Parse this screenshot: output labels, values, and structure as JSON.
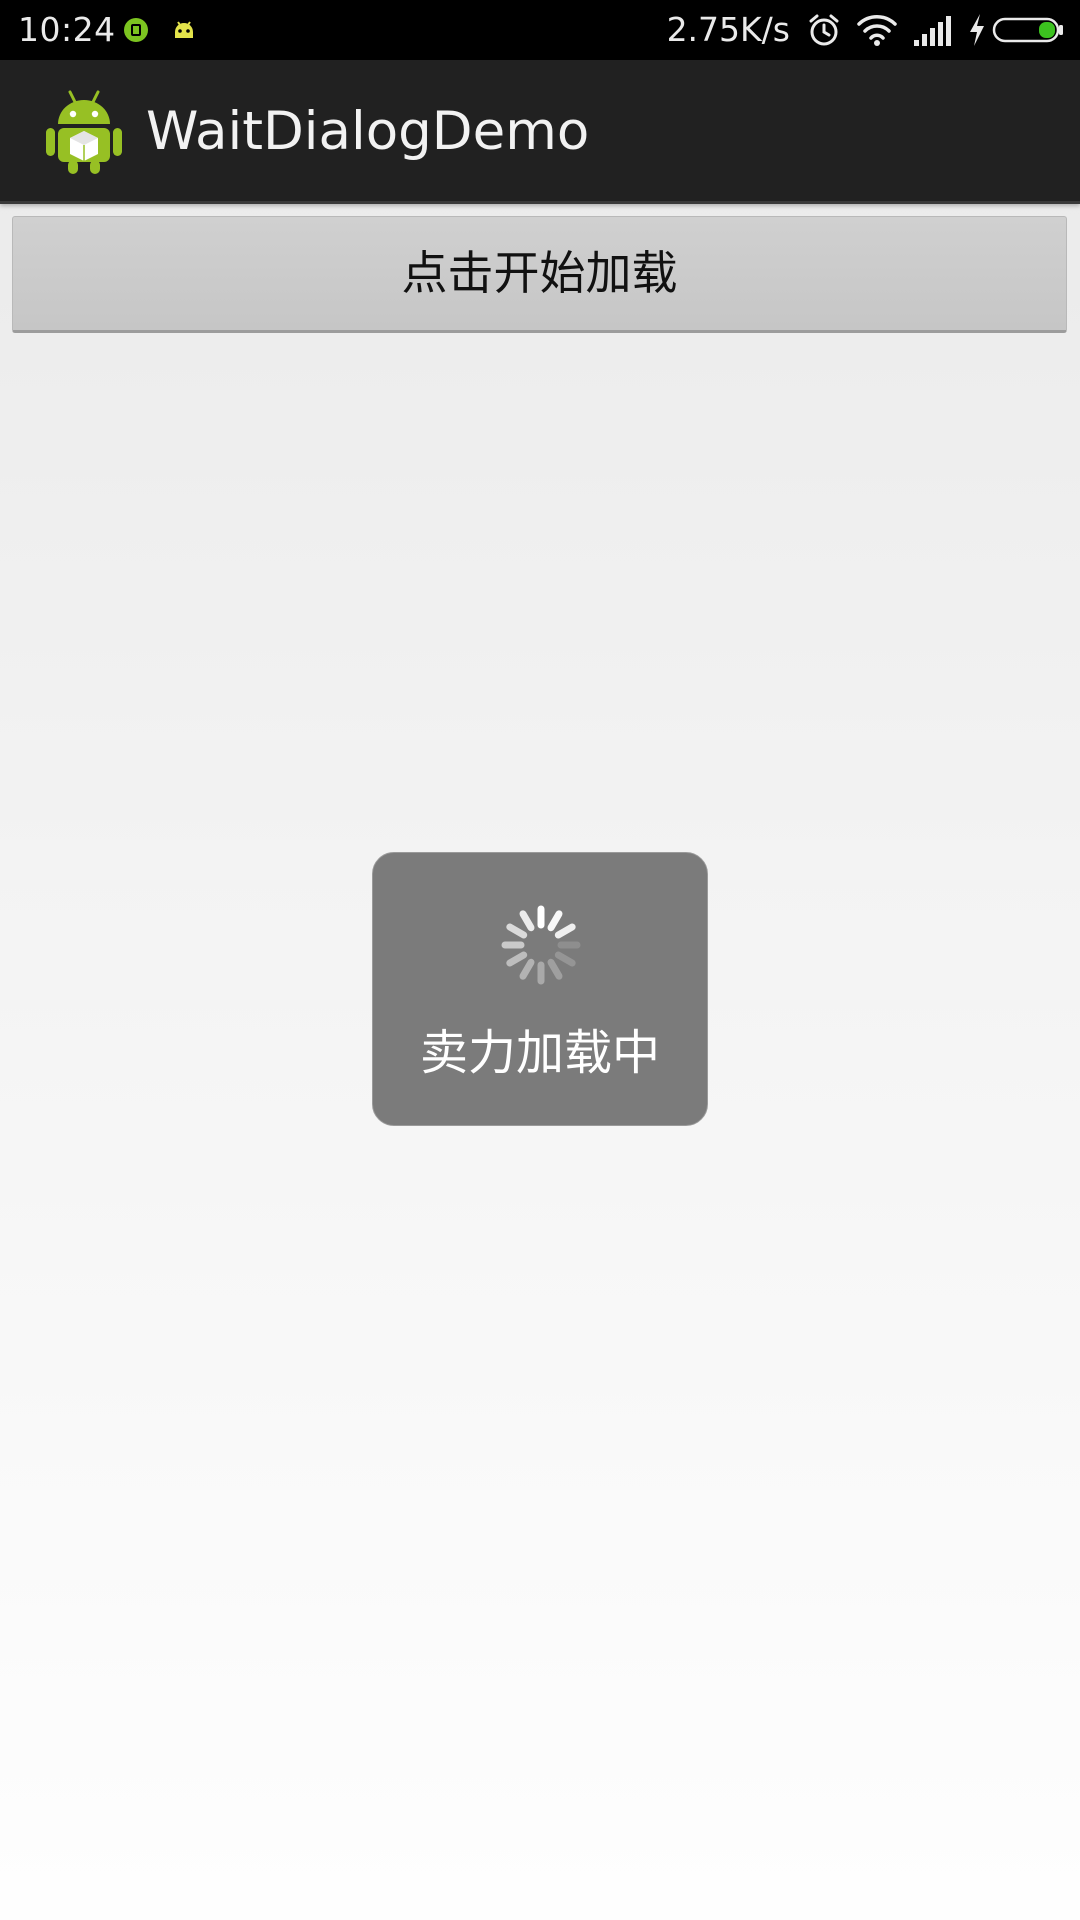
{
  "status_bar": {
    "time": "10:24",
    "network_speed": "2.75K/s",
    "icons": [
      "android-debug-icon",
      "android-notification-icon",
      "alarm-icon",
      "wifi-icon",
      "signal-icon",
      "charging-icon",
      "battery-icon"
    ]
  },
  "action_bar": {
    "title": "WaitDialogDemo",
    "icon": "android-app-icon"
  },
  "main": {
    "load_button_label": "点击开始加载"
  },
  "wait_dialog": {
    "message": "卖力加载中",
    "icon": "loading-spinner-icon"
  },
  "colors": {
    "status_bar_bg": "#000000",
    "action_bar_bg": "#212121",
    "dialog_bg": "#7b7b7b",
    "battery_green": "#3cc21f",
    "android_green": "#97c024"
  }
}
